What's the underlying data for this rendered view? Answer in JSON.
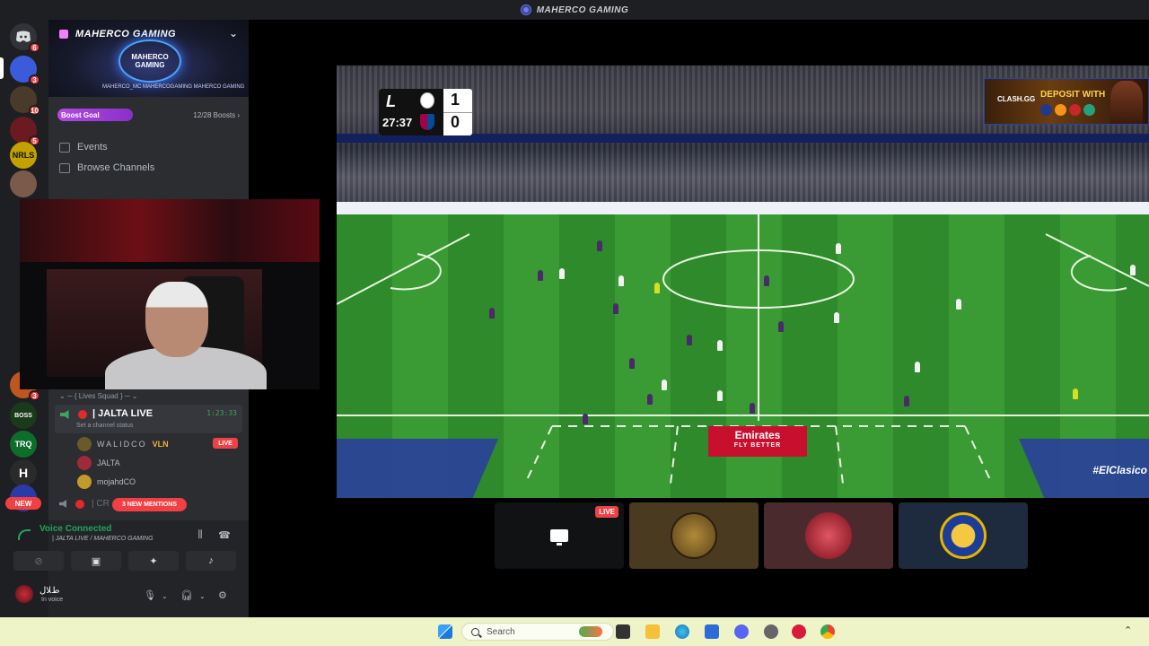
{
  "window": {
    "title": "MAHERCO GAMING"
  },
  "rail": {
    "servers": [
      {
        "label": "",
        "badge": "6",
        "color": "#313338"
      },
      {
        "label": "",
        "badge": "3",
        "color": "#3b5bdb"
      },
      {
        "label": "",
        "badge": "10",
        "color": "#4a3a2a"
      },
      {
        "label": "",
        "badge": "5",
        "color": "#6a1a20"
      },
      {
        "label": "NRLS",
        "badge": "",
        "color": "#c2a100"
      },
      {
        "label": "",
        "badge": "",
        "color": "#7a5a4a"
      }
    ],
    "lower_servers": [
      {
        "label": "",
        "badge": "3",
        "color": "#c0561f"
      },
      {
        "label": "BOSS",
        "badge": "",
        "color": "#1a3a1a"
      },
      {
        "label": "TRQ",
        "badge": "",
        "color": "#0e6d2a"
      },
      {
        "label": "H",
        "badge": "",
        "color": "#2a2a2a"
      },
      {
        "label": "",
        "badge": "",
        "color": "#2a3aa8"
      }
    ],
    "new_label": "NEW"
  },
  "sidebar": {
    "server_name": "MAHERCO GAMING",
    "emblem_text": "MAHERCO GAMING",
    "socials": "MAHERCO_MC  MAHERCOGAMING  MAHERCO GAMING",
    "boost_goal_label": "Boost Goal",
    "boost_count": "12/28 Boosts",
    "nav": [
      {
        "label": "Events"
      },
      {
        "label": "Browse Channels"
      }
    ],
    "squad_header": "Lives Squad",
    "live_channel": {
      "name": "| JALTA LIVE",
      "timer": "1:23:33",
      "status_placeholder": "Set a channel status"
    },
    "members": [
      {
        "name": "WALIDCO",
        "tag": "VLN",
        "live": true,
        "avatar_color": "#6a5a2a"
      },
      {
        "name": "JALTA",
        "tag": "",
        "live": false,
        "avatar_color": "#a12a3a"
      },
      {
        "name": "mojahdCO",
        "tag": "",
        "live": false,
        "avatar_color": "#c29a2a"
      }
    ],
    "live_badge": "LIVE",
    "next_channel": "| CR",
    "mentions_label": "3 NEW MENTIONS"
  },
  "voice": {
    "status": "Voice Connected",
    "channel_path": "| JALTA LIVE / MAHERCO GAMING",
    "user_name": "ﻁﻼﻝ",
    "user_status": "In voice"
  },
  "stream": {
    "score": {
      "time": "27:37",
      "home": "1",
      "away": "0",
      "league_mark": "L"
    },
    "ad_brand": "CLASH.GG",
    "ad_text": "DEPOSIT WITH",
    "sponsor": "Emirates",
    "sponsor_tagline": "FLY BETTER",
    "hashtag": "#ElClasico",
    "colors": {
      "home": "#f2f2f2",
      "away": "#4b2a6b",
      "referee": "#d6e020"
    }
  },
  "tiles": [
    {
      "kind": "screen",
      "live": "LIVE",
      "bg": "#111214"
    },
    {
      "kind": "avatar",
      "bg": "#4a3a20",
      "avatar_color": "#8a6a2a"
    },
    {
      "kind": "avatar",
      "bg": "#4a2a2d",
      "avatar_color": "#b01f2e"
    },
    {
      "kind": "avatar",
      "bg": "#1e2a3e",
      "avatar_color": "#e7b400"
    }
  ],
  "taskbar": {
    "search_placeholder": "Search"
  }
}
